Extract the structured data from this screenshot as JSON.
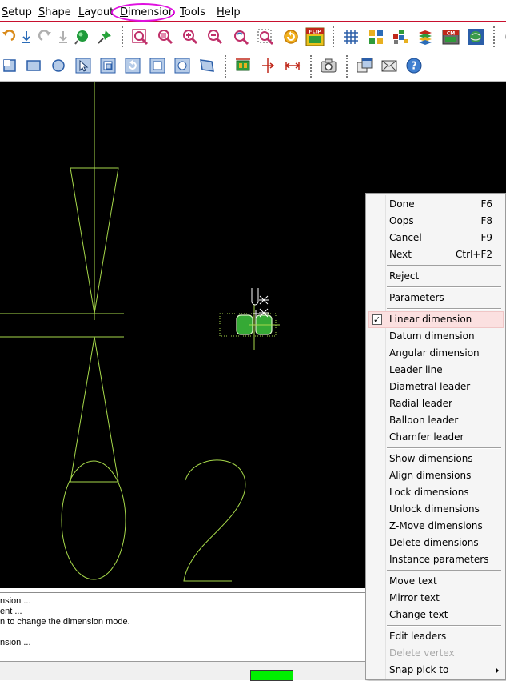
{
  "menubar": {
    "items": [
      {
        "label": "Setup",
        "key": "S"
      },
      {
        "label": "Shape",
        "key": "S"
      },
      {
        "label": "Layout",
        "key": "L"
      },
      {
        "label": "Dimension",
        "key": "D"
      },
      {
        "label": "Tools",
        "key": "T"
      },
      {
        "label": "Help",
        "key": "H"
      }
    ],
    "highlighted": "Dimension"
  },
  "toolbar1": {
    "icons": [
      "undo-icon",
      "down-arrow-icon",
      "redo-icon",
      "down-arrow-gray-icon",
      "green-ball-icon",
      "pushpin-icon",
      "zoom-window-icon",
      "zoom-all-icon",
      "zoom-in-icon",
      "zoom-out-icon",
      "zoom-previous-icon",
      "zoom-fit-icon",
      "redraw-icon",
      "flip-icon",
      "grid-icon",
      "color-icon",
      "layers-icon",
      "stack-icon",
      "cm-icon",
      "globe-icon"
    ],
    "flip_label": "FLIP",
    "cm_label": "CM"
  },
  "toolbar2": {
    "icons": [
      "corner-icon",
      "rectangle-icon",
      "circle-icon",
      "select-pointer-icon",
      "copy-shape-icon",
      "rotate-icon",
      "square-icon",
      "circle-frame-icon",
      "parallelogram-icon",
      "footprint-icon",
      "dimension-vertical-icon",
      "dimension-horizontal-icon",
      "camera-icon",
      "windows-icon",
      "envelope-icon",
      "help-icon"
    ]
  },
  "canvas": {
    "background": "#000000",
    "line_color": "#a6d84a",
    "pad_color": "#35a935"
  },
  "command_window": {
    "lines": [
      "nsion ...",
      "ent ...",
      "n to change the dimension mode.",
      "",
      "nsion ..."
    ]
  },
  "context_menu": {
    "items": [
      {
        "label": "Done",
        "shortcut": "F6"
      },
      {
        "label": "Oops",
        "shortcut": "F8"
      },
      {
        "label": "Cancel",
        "shortcut": "F9"
      },
      {
        "label": "Next",
        "shortcut": "Ctrl+F2"
      },
      {
        "sep": true
      },
      {
        "label": "Reject"
      },
      {
        "sep": true
      },
      {
        "label": "Parameters"
      },
      {
        "sep": true
      },
      {
        "label": "Linear dimension",
        "checked": true,
        "highlighted": true
      },
      {
        "label": "Datum dimension"
      },
      {
        "label": "Angular dimension"
      },
      {
        "label": "Leader line"
      },
      {
        "label": "Diametral leader"
      },
      {
        "label": "Radial leader"
      },
      {
        "label": "Balloon leader"
      },
      {
        "label": "Chamfer leader"
      },
      {
        "sep": true
      },
      {
        "label": "Show dimensions"
      },
      {
        "label": "Align dimensions"
      },
      {
        "label": "Lock dimensions"
      },
      {
        "label": "Unlock dimensions"
      },
      {
        "label": "Z-Move dimensions"
      },
      {
        "label": "Delete dimensions"
      },
      {
        "label": "Instance parameters"
      },
      {
        "sep": true
      },
      {
        "label": "Move text"
      },
      {
        "label": "Mirror text"
      },
      {
        "label": "Change text"
      },
      {
        "sep": true
      },
      {
        "label": "Edit leaders"
      },
      {
        "label": "Delete vertex",
        "disabled": true
      },
      {
        "label": "Snap pick to",
        "submenu": true
      }
    ],
    "checkmark": "✓"
  },
  "status": {
    "indicator_color": "#00f000"
  }
}
